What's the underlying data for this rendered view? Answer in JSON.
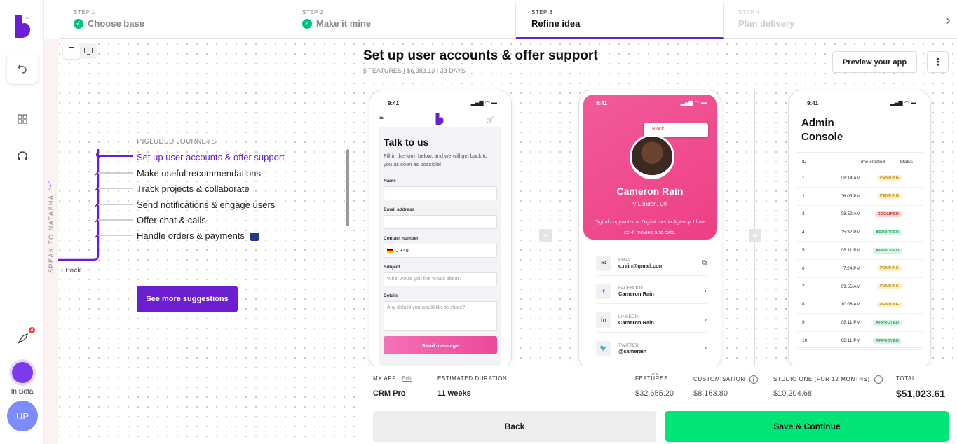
{
  "rail": {
    "logo_tm": "™",
    "beta_label": "In Beta",
    "avatar_initials": "UP",
    "notif_count": "4"
  },
  "steps": [
    {
      "num": "STEP 1",
      "name": "Choose base",
      "state": "done"
    },
    {
      "num": "STEP 2",
      "name": "Make it mine",
      "state": "done"
    },
    {
      "num": "STEP 3",
      "name": "Refine idea",
      "state": "active"
    },
    {
      "num": "STEP 4",
      "name": "Plan delivery",
      "state": "future"
    }
  ],
  "speak_label": "SPEAK TO NATASHA",
  "journeys": {
    "title": "INCLUDED JOURNEYS",
    "items": [
      "Set up user accounts & offer support",
      "Make useful recommendations",
      "Track projects & collaborate",
      "Send notifications & engage users",
      "Offer chat & calls",
      "Handle orders & payments"
    ],
    "back": "‹ Back",
    "suggest_button": "See more suggestions"
  },
  "main": {
    "title": "Set up user accounts & offer support",
    "subtitle": "5 FEATURES | $6,383.13 | 33 DAYS",
    "preview_button": "Preview your app"
  },
  "phone1": {
    "time": "9:41",
    "title": "Talk to us",
    "desc": "Fill in the form below, and we will get back to you as soon as possible!",
    "name_label": "Name",
    "email_label": "Email address",
    "contact_label": "Contact number",
    "phone_prefix": "+49",
    "subject_label": "Subject",
    "subject_placeholder": "What would you like to talk about?",
    "details_label": "Details",
    "details_placeholder": "Any details you would like to share?",
    "send_button": "Send message"
  },
  "phone2": {
    "time": "9:41",
    "block_label": "Block",
    "name": "Cameron Rain",
    "location": "London, UK",
    "bio": "Digital copywriter at Digital media Agency. I love sci-fi movies and cats.",
    "rows": [
      {
        "key": "EMAIL",
        "value": "c.rain@gmail.com",
        "icon": "mail-icon",
        "action": "⧉"
      },
      {
        "key": "FACEBOOK",
        "value": "Cameron Rain",
        "icon": "facebook-icon",
        "action": "›"
      },
      {
        "key": "LINKEDIN",
        "value": "Cameron Rain",
        "icon": "linkedin-icon",
        "action": "›"
      },
      {
        "key": "TWITTER",
        "value": "@camerain",
        "icon": "twitter-icon",
        "action": "›"
      }
    ]
  },
  "phone3": {
    "time": "9:41",
    "title_line1": "Admin",
    "title_line2": "Console",
    "headers": {
      "id": "ID",
      "time": "Time created",
      "status": "Status"
    },
    "rows": [
      {
        "id": "1",
        "time": "08:14 AM",
        "status": "PENDING"
      },
      {
        "id": "2",
        "time": "06:05 PM",
        "status": "PENDING"
      },
      {
        "id": "3",
        "time": "08:59 AM",
        "status": "DECLINED"
      },
      {
        "id": "4",
        "time": "05:32 PM",
        "status": "APPROVED"
      },
      {
        "id": "5",
        "time": "08:11 PM",
        "status": "APPROVED"
      },
      {
        "id": "6",
        "time": "7:24 PM",
        "status": "PENDING"
      },
      {
        "id": "7",
        "time": "09:55 AM",
        "status": "PENDING"
      },
      {
        "id": "8",
        "time": "10:08 AM",
        "status": "PENDING"
      },
      {
        "id": "9",
        "time": "08:11 PM",
        "status": "APPROVED"
      },
      {
        "id": "10",
        "time": "08:11 PM",
        "status": "APPROVED"
      }
    ]
  },
  "footer": {
    "my_app_label": "MY APP",
    "edit_label": "Edit",
    "app_name": "CRM Pro",
    "duration_label": "ESTIMATED DURATION",
    "duration": "11 weeks",
    "features_label": "FEATURES",
    "features_value": "$32,655.20",
    "custom_label": "CUSTOMISATION",
    "custom_value": "$8,163.80",
    "studio_label": "STUDIO ONE (FOR 12 MONTHS)",
    "studio_value": "$10,204.68",
    "total_label": "TOTAL",
    "total_value": "$51,023.61",
    "back_button": "Back",
    "save_button": "Save & Continue"
  },
  "colors": {
    "brand": "#6c1fd1",
    "success": "#00e576",
    "pink": "#ee3f86"
  }
}
